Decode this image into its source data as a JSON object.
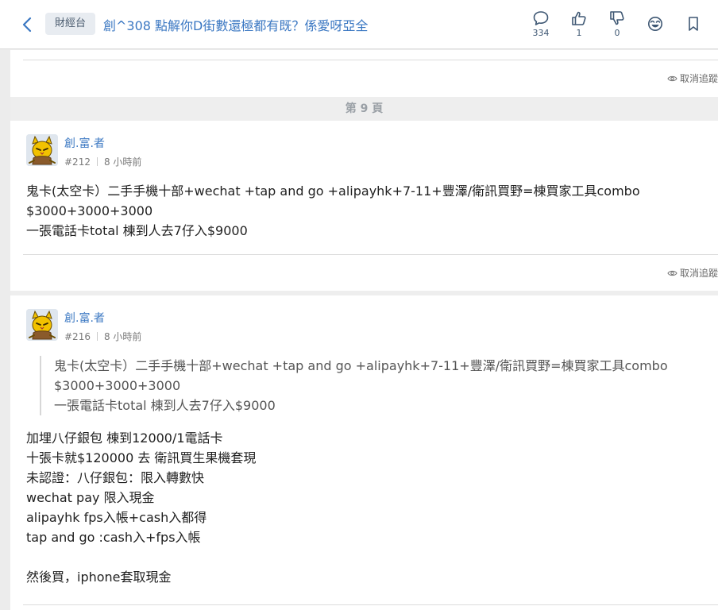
{
  "header": {
    "channel": "財經台",
    "title": "創^308 點解你D街數還極都有既？係愛呀亞全",
    "reply_count": "334",
    "upvote_count": "1",
    "downvote_count": "0"
  },
  "unfollow_label": "取消追蹤",
  "page_label": "第 9 頁",
  "posts": [
    {
      "username": "創.富.者",
      "floor": "#212",
      "time": "8 小時前",
      "body": "鬼卡(太空卡）二手手機十部+wechat +tap and go +alipayhk+7-11+豐澤/衛訊買野=棟買家工具combo\n$3000+3000+3000\n一張電話卡total 棟到人去7仔入$9000"
    },
    {
      "username": "創.富.者",
      "floor": "#216",
      "time": "8 小時前",
      "quote": "鬼卡(太空卡）二手手機十部+wechat +tap and go +alipayhk+7-11+豐澤/衛訊買野=棟買家工具combo\n$3000+3000+3000\n一張電話卡total 棟到人去7仔入$9000",
      "body": "加埋八仔銀包 棟到12000/1電話卡\n十張卡就$120000 去 衛訊買生果機套現\n未認證：八仔銀包：限入轉數快\nwechat pay 限入現金\nalipayhk fps入帳+cash入都得\ntap and go :cash入+fps入帳\n\n然後買，iphone套取現金"
    }
  ],
  "colors": {
    "link_blue": "#3a77c2",
    "text": "#1f1f1f",
    "page_bg": "#ececec",
    "card_bg": "#ffffff"
  }
}
